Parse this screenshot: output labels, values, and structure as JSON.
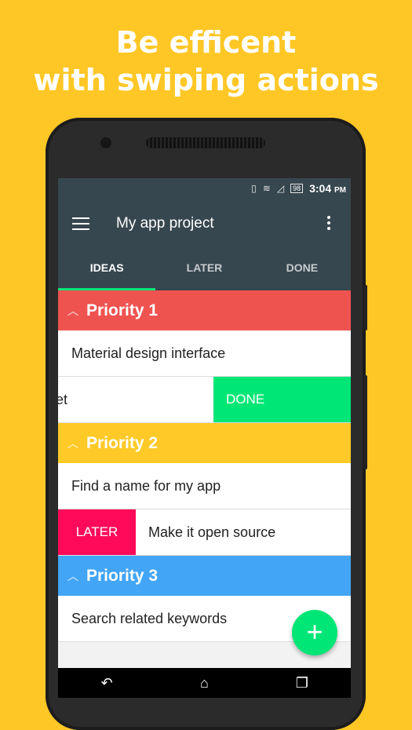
{
  "headline": {
    "line1": "Be efficent",
    "line2": "with swiping actions"
  },
  "status_bar": {
    "time": "3:04",
    "ampm": "PM",
    "battery": "98",
    "vibrate_icon": "vibrate-icon",
    "wifi_icon": "wifi-icon",
    "signal_icon": "signal-icon"
  },
  "app_bar": {
    "title": "My app project",
    "menu_icon": "hamburger-menu-icon",
    "more_icon": "more-vertical-icon"
  },
  "tabs": [
    {
      "label": "IDEAS",
      "active": true
    },
    {
      "label": "LATER",
      "active": false
    },
    {
      "label": "DONE",
      "active": false
    }
  ],
  "sections": [
    {
      "title": "Priority 1",
      "color": "#EF5350",
      "items": [
        {
          "text": "Material design interface"
        },
        {
          "text": "ket",
          "swipe_action": "DONE",
          "swipe_color": "#00E676"
        }
      ]
    },
    {
      "title": "Priority 2",
      "color": "#FFCA28",
      "items": [
        {
          "text": "Find a name for my app"
        },
        {
          "text": "Make it open source",
          "swipe_action": "LATER",
          "swipe_color": "#FF0A5A"
        }
      ]
    },
    {
      "title": "Priority 3",
      "color": "#42A5F5",
      "items": [
        {
          "text": "Search related keywords"
        }
      ]
    }
  ],
  "fab": {
    "label": "+",
    "icon": "add-icon",
    "color": "#00E676"
  },
  "nav": {
    "back_icon": "back-icon",
    "home_icon": "home-icon",
    "recents_icon": "recents-icon"
  },
  "colors": {
    "background": "#FFC726",
    "app_bar": "#37474F",
    "tab_indicator": "#00E676"
  }
}
